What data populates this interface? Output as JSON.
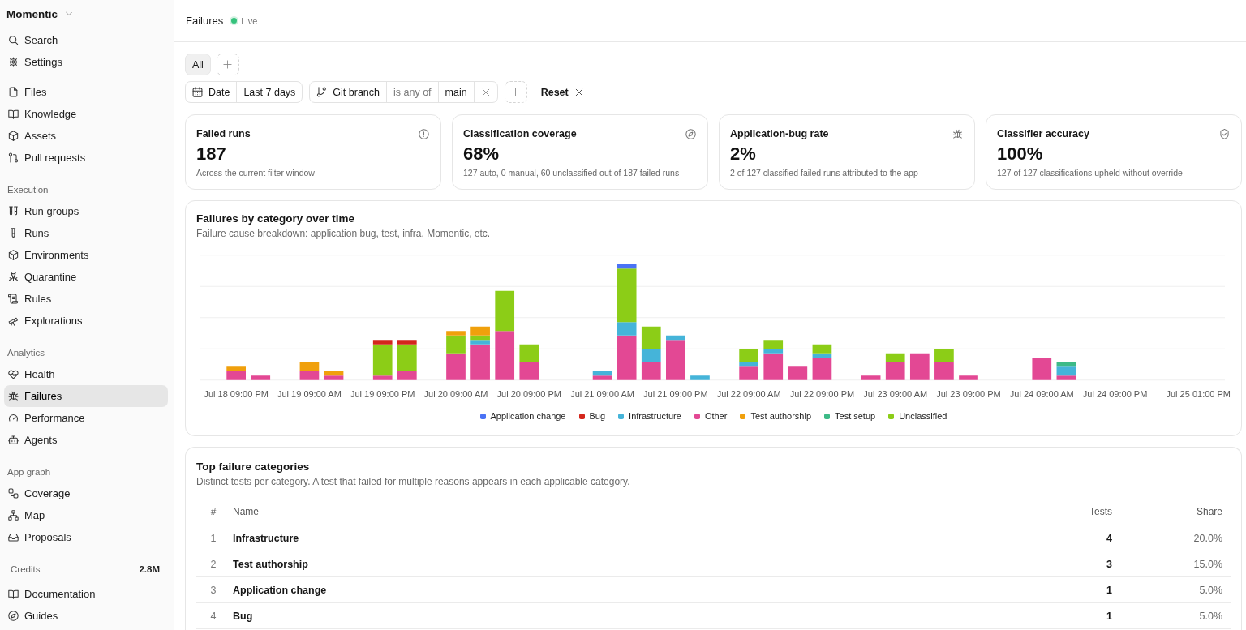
{
  "sidebar": {
    "workspace": "Momentic",
    "groups": [
      {
        "items": [
          {
            "label": "Search",
            "selected": false
          },
          {
            "label": "Settings",
            "selected": false
          }
        ]
      },
      {
        "items": [
          {
            "label": "Files",
            "selected": false
          },
          {
            "label": "Knowledge",
            "selected": false
          },
          {
            "label": "Assets",
            "selected": false
          },
          {
            "label": "Pull requests",
            "selected": false
          }
        ]
      },
      {
        "title": "Execution",
        "items": [
          {
            "label": "Run groups",
            "selected": false
          },
          {
            "label": "Runs",
            "selected": false
          },
          {
            "label": "Environments",
            "selected": false
          },
          {
            "label": "Quarantine",
            "selected": false
          },
          {
            "label": "Rules",
            "selected": false
          },
          {
            "label": "Explorations",
            "selected": false
          }
        ]
      },
      {
        "title": "Analytics",
        "items": [
          {
            "label": "Health",
            "selected": false
          },
          {
            "label": "Failures",
            "selected": true
          },
          {
            "label": "Performance",
            "selected": false
          },
          {
            "label": "Agents",
            "selected": false
          }
        ]
      },
      {
        "title": "App graph",
        "items": [
          {
            "label": "Coverage",
            "selected": false
          },
          {
            "label": "Map",
            "selected": false
          },
          {
            "label": "Proposals",
            "selected": false
          }
        ]
      }
    ],
    "credits": {
      "label": "Credits",
      "value": "2.8M"
    },
    "footer_items": [
      {
        "label": "Documentation",
        "selected": false
      },
      {
        "label": "Guides",
        "selected": false
      }
    ]
  },
  "topbar": {
    "title": "Failures",
    "status": {
      "label": "Live",
      "on": true
    }
  },
  "views": [
    {
      "label": "All",
      "selected": true
    }
  ],
  "filters": [
    {
      "kind": "date",
      "field": "Date",
      "value": "Last 7 days",
      "removable": false
    },
    {
      "kind": "branch",
      "field": "Git branch",
      "operator": "is any of",
      "value": "main",
      "removable": true
    }
  ],
  "reset_label": "Reset",
  "stats": [
    {
      "title": "Failed runs",
      "value": "187",
      "note": "Across the current filter window"
    },
    {
      "title": "Classification coverage",
      "value": "68%",
      "note": "127 auto, 0 manual, 60 unclassified out of 187 failed runs"
    },
    {
      "title": "Application-bug rate",
      "value": "2%",
      "note": "2 of 127 classified failed runs attributed to the app"
    },
    {
      "title": "Classifier accuracy",
      "value": "100%",
      "note": "127 of 127 classifications upheld without override"
    }
  ],
  "chart": {
    "title": "Failures by category over time",
    "subtitle": "Failure cause breakdown: application bug, test, infra, Momentic, etc.",
    "x_labels": [
      "Jul 18 09:00 PM",
      "Jul 19 09:00 AM",
      "Jul 19 09:00 PM",
      "Jul 20 09:00 AM",
      "Jul 20 09:00 PM",
      "Jul 21 09:00 AM",
      "Jul 21 09:00 PM",
      "Jul 22 09:00 AM",
      "Jul 22 09:00 PM",
      "Jul 23 09:00 AM",
      "Jul 23 09:00 PM",
      "Jul 24 09:00 AM",
      "Jul 24 09:00 PM",
      "Jul 25 01:00 PM"
    ],
    "legend": [
      {
        "label": "Application change",
        "color": "#4a72f5"
      },
      {
        "label": "Bug",
        "color": "#d4261c"
      },
      {
        "label": "Infrastructure",
        "color": "#45b4d9"
      },
      {
        "label": "Other",
        "color": "#e34894"
      },
      {
        "label": "Test authorship",
        "color": "#f0a00c"
      },
      {
        "label": "Test setup",
        "color": "#3dba87"
      },
      {
        "label": "Unclassified",
        "color": "#8ccd17"
      }
    ]
  },
  "table": {
    "title": "Top failure categories",
    "subtitle": "Distinct tests per category. A test that failed for multiple reasons appears in each applicable category.",
    "columns": [
      "#",
      "Name",
      "Tests",
      "Share"
    ],
    "rows": [
      {
        "rank": "1",
        "name": "Infrastructure",
        "tests": "4",
        "share": "20.0%"
      },
      {
        "rank": "2",
        "name": "Test authorship",
        "tests": "3",
        "share": "15.0%"
      },
      {
        "rank": "3",
        "name": "Application change",
        "tests": "1",
        "share": "5.0%"
      },
      {
        "rank": "4",
        "name": "Bug",
        "tests": "1",
        "share": "5.0%"
      }
    ]
  }
}
